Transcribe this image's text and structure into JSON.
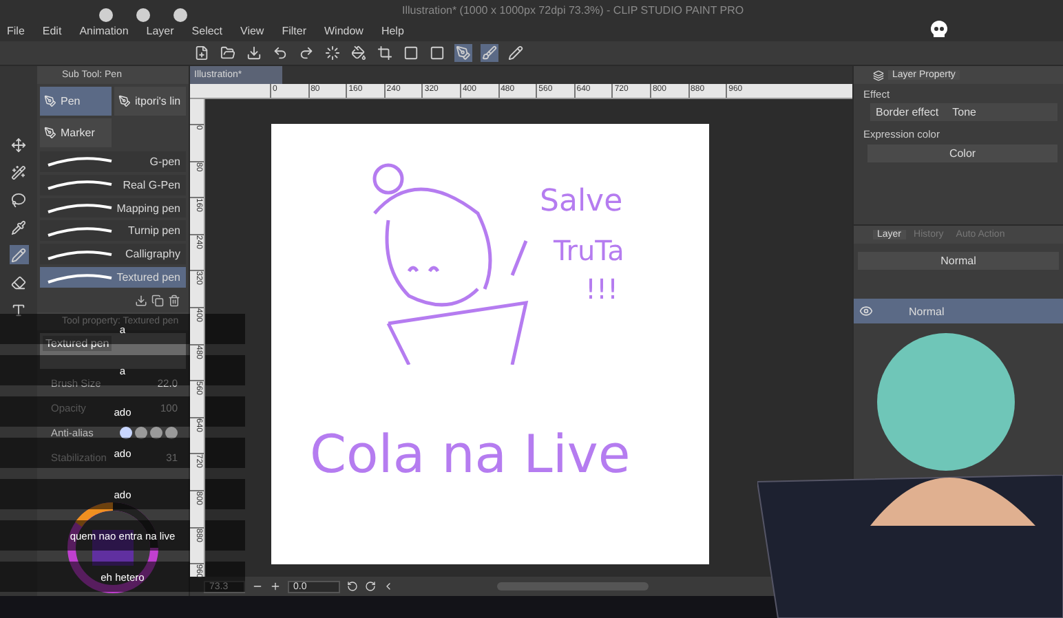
{
  "window": {
    "title": "Illustration* (1000 x 1000px 72dpi 73.3%) - CLIP STUDIO PAINT PRO"
  },
  "menu": [
    "File",
    "Edit",
    "Animation",
    "Layer",
    "Select",
    "View",
    "Filter",
    "Window",
    "Help"
  ],
  "sub_tool": {
    "title": "Sub Tool: Pen",
    "groups": [
      {
        "label": "Pen",
        "selected": true
      },
      {
        "label": "itpori's lin",
        "selected": false
      },
      {
        "label": "Marker",
        "selected": false
      }
    ],
    "brushes": [
      {
        "name": "G-pen",
        "selected": false
      },
      {
        "name": "Real G-Pen",
        "selected": false
      },
      {
        "name": "Mapping pen",
        "selected": false
      },
      {
        "name": "Turnip pen",
        "selected": false
      },
      {
        "name": "Calligraphy",
        "selected": false
      },
      {
        "name": "Textured pen",
        "selected": true
      }
    ]
  },
  "tool_property": {
    "title": "Tool property: Textured pen",
    "preview": "Textured pen",
    "settings": [
      {
        "kind": "number",
        "label": "Brush Size",
        "value": "22.0"
      },
      {
        "kind": "number",
        "label": "Opacity",
        "value": "100"
      },
      {
        "kind": "antialias",
        "label": "Anti-alias"
      },
      {
        "kind": "number",
        "label": "Stabilization",
        "value": "31"
      }
    ]
  },
  "document": {
    "tab": "Illustration*",
    "top_ruler": [
      "0",
      "80",
      "160",
      "240",
      "320",
      "400",
      "480",
      "560",
      "640",
      "720",
      "800",
      "880",
      "960"
    ],
    "side_ruler": [
      "0",
      "80",
      "160",
      "240",
      "320",
      "400",
      "480",
      "560",
      "640",
      "720",
      "800",
      "880",
      "960"
    ],
    "canvas_text": [
      "Salve",
      "TruTa",
      "!!!",
      "Cola na Live"
    ],
    "zoom": "73.3",
    "angle": "0.0"
  },
  "layer_property": {
    "title": "Layer Property",
    "effect_label": "Effect",
    "effects": [
      "Border effect",
      "Tone"
    ],
    "expression_label": "Expression color",
    "expression_value": "Color"
  },
  "layers": {
    "tabs": [
      {
        "label": "Layer",
        "selected": true
      },
      {
        "label": "History",
        "selected": false
      },
      {
        "label": "Auto Action",
        "selected": false
      }
    ],
    "blend": "Normal",
    "rows": [
      {
        "name": "Normal",
        "selected": true,
        "visible": true
      }
    ]
  },
  "chat": [
    "a",
    "a",
    "ado",
    "ado",
    "ado",
    "quem nao entra na live",
    "eh hetero"
  ]
}
